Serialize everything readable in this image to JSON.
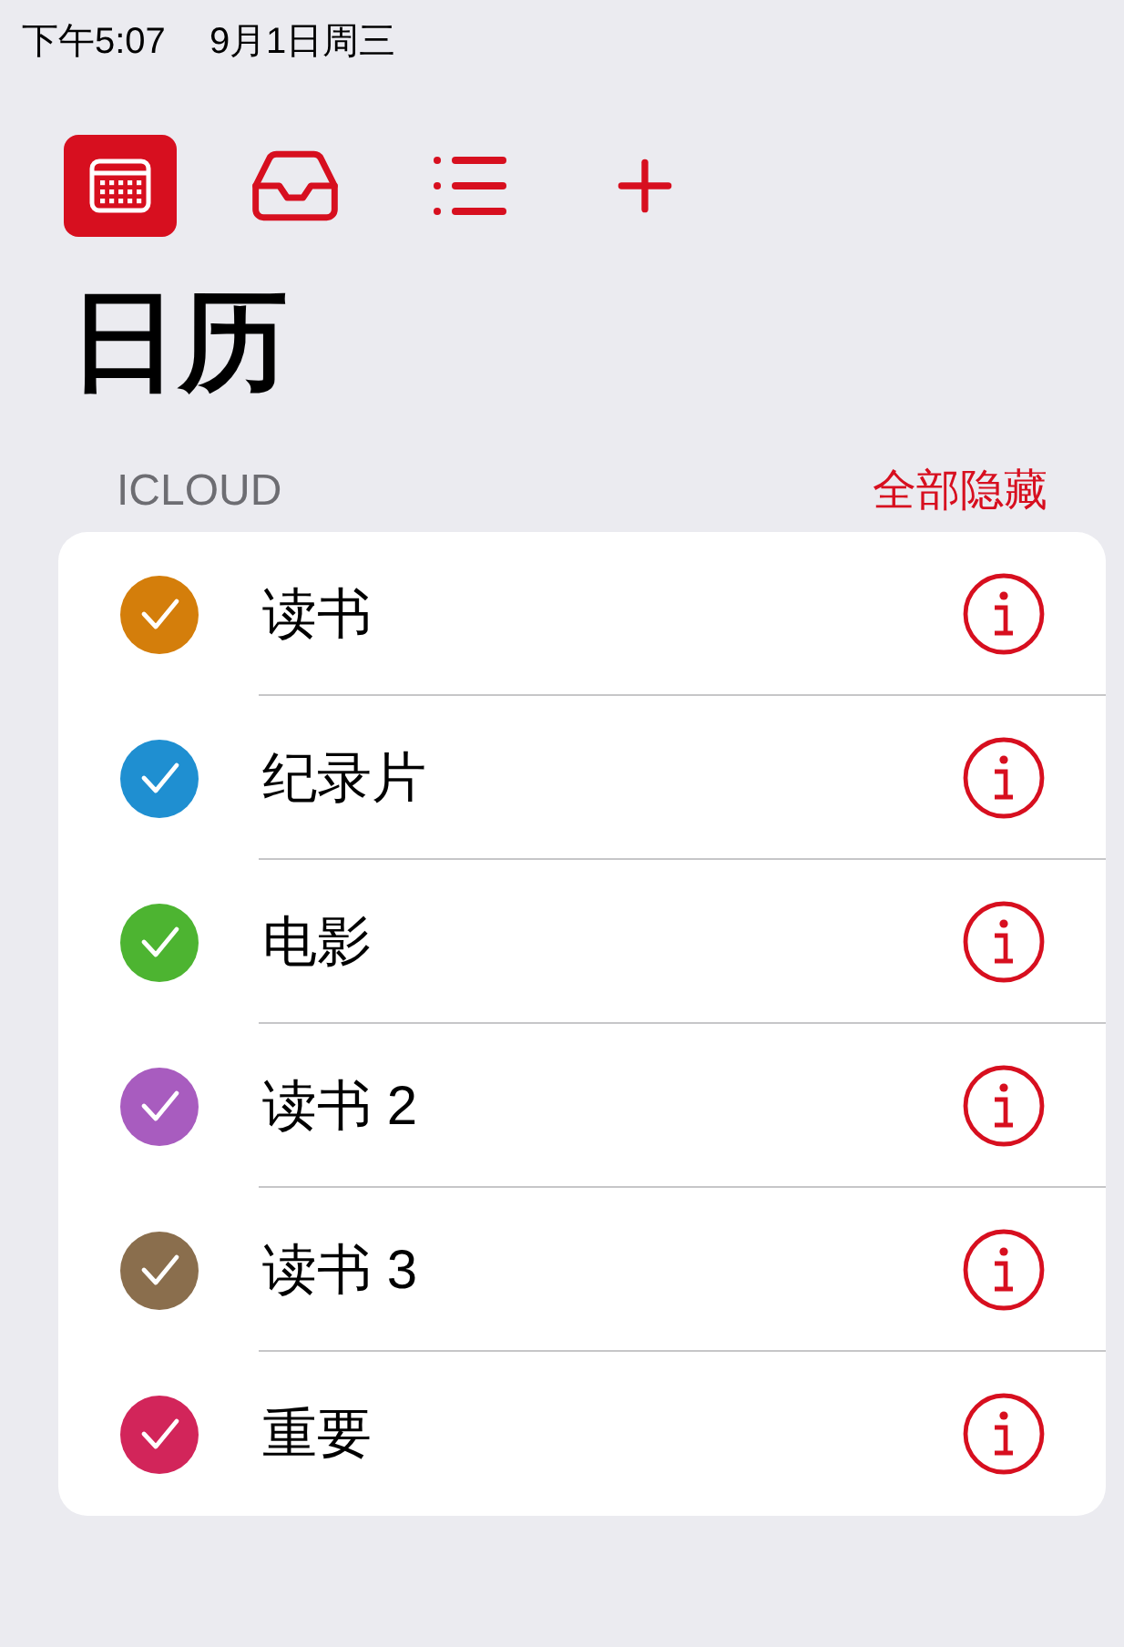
{
  "status_bar": {
    "time": "下午5:07",
    "date": "9月1日周三"
  },
  "toolbar": [
    {
      "kind": "calendar",
      "selected": true
    },
    {
      "kind": "inbox",
      "selected": false
    },
    {
      "kind": "list",
      "selected": false
    },
    {
      "kind": "add",
      "selected": false
    }
  ],
  "title": "日历",
  "section": {
    "header": "ICLOUD",
    "action": "全部隐藏"
  },
  "calendars": [
    {
      "name": "读书",
      "checked": true,
      "color": "#d47e0b"
    },
    {
      "name": "纪录片",
      "checked": true,
      "color": "#1f8fd1"
    },
    {
      "name": "电影",
      "checked": true,
      "color": "#4db431"
    },
    {
      "name": "读书 2",
      "checked": true,
      "color": "#a85cbf"
    },
    {
      "name": "读书 3",
      "checked": true,
      "color": "#8a6e4d"
    },
    {
      "name": "重要",
      "checked": true,
      "color": "#d2255a"
    }
  ]
}
